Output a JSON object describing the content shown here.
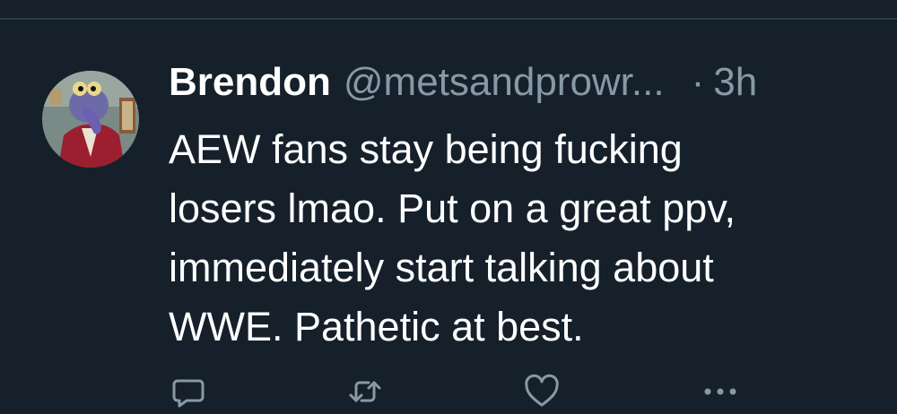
{
  "tweet": {
    "display_name": "Brendon",
    "handle": "@metsandprowr...",
    "separator": "·",
    "time": "3h",
    "text": "AEW fans stay being fucking\nlosers lmao. Put on a great ppv,\nimmediately start talking about\nWWE. Pathetic at best."
  },
  "actions": {
    "icons": [
      "reply-icon",
      "retweet-icon",
      "like-icon",
      "more-icon"
    ]
  },
  "colors": {
    "background": "#15202b",
    "primary_text": "#ffffff",
    "secondary_text": "#8899a6",
    "divider": "#2f3b47"
  }
}
